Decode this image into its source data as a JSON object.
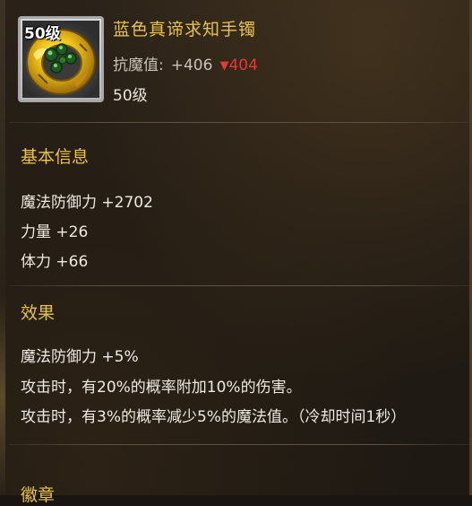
{
  "item": {
    "level_tag": "50级",
    "name": "蓝色真谛求知手镯",
    "resist_label": "抗魔值:",
    "resist_value": "+406",
    "resist_delta_icon": "triangle-down-icon",
    "resist_delta": "404",
    "level": "50级"
  },
  "basic": {
    "title": "基本信息",
    "stats": [
      "魔法防御力 +2702",
      "力量 +26",
      "体力 +66"
    ]
  },
  "effects": {
    "title": "效果",
    "lines": [
      "魔法防御力 +5%",
      "攻击时，有20%的概率附加10%的伤害。",
      "攻击时，有3%的概率减少5%的魔法值。（冷却时间1秒）"
    ]
  },
  "emblem": {
    "title": "徽章"
  },
  "colors": {
    "title_gold": "#e8c24a",
    "text_white": "#eeeae3",
    "delta_red": "#e03a3a"
  }
}
